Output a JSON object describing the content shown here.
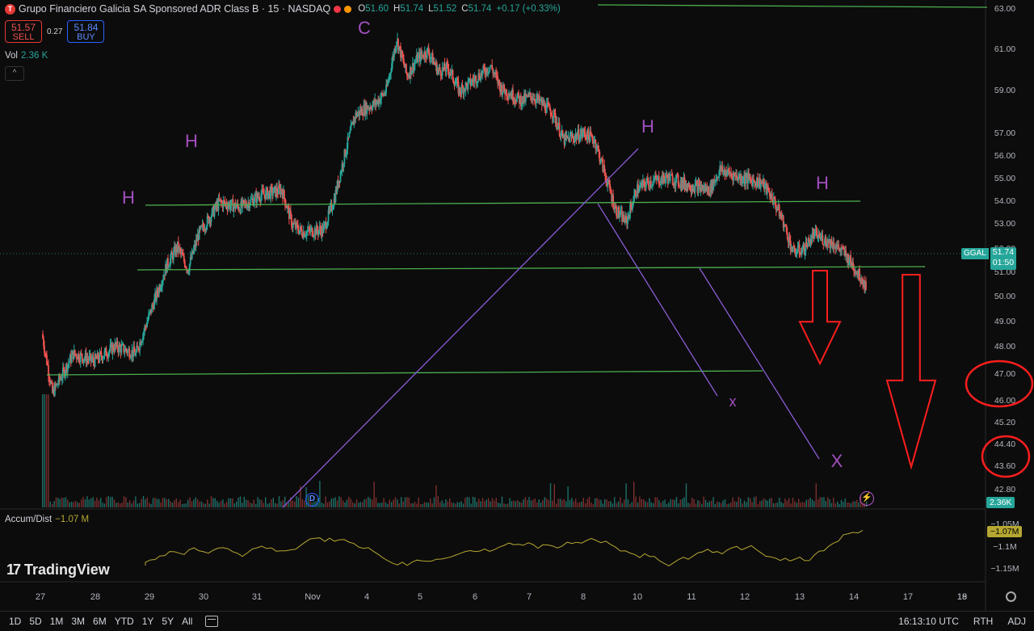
{
  "header": {
    "symbol_icon": "T",
    "title": "Grupo Financiero Galicia SA Sponsored ADR Class B · 15 · NASDAQ",
    "ohlc": {
      "o": "51.60",
      "h": "51.74",
      "l": "51.52",
      "c": "51.74",
      "change": "+0.17 (+0.33%)"
    },
    "ohlc_labels": {
      "o": "O",
      "h": "H",
      "l": "L",
      "c": "C"
    },
    "dot_colors": [
      "#f23645",
      "#ff9800"
    ]
  },
  "trade": {
    "sell_price": "51.57",
    "sell_label": "SELL",
    "spread": "0.27",
    "buy_price": "51.84",
    "buy_label": "BUY"
  },
  "volume_legend": {
    "label": "Vol",
    "value": "2.36 K"
  },
  "collapse_icon": "^",
  "ad_legend": {
    "label": "Accum/Dist",
    "value": "−1.07 M"
  },
  "logo": {
    "mark": "17",
    "text": "TradingView"
  },
  "price_tag": {
    "symbol": "GGAL",
    "price": "51.74",
    "countdown": "01:50"
  },
  "volume_tag": "2.36K",
  "ad_tag": "−1.07M",
  "dividend_marker": "D",
  "flash_icon": "⚡",
  "toolbar": {
    "timeframes": [
      "1D",
      "5D",
      "1M",
      "3M",
      "6M",
      "YTD",
      "1Y",
      "5Y",
      "All"
    ],
    "time": "16:13:10 UTC",
    "session": "RTH",
    "adjust": "ADJ"
  },
  "colors": {
    "up": "#26a69a",
    "down": "#ef5350",
    "support": "#4caf50",
    "trend": "#8a5bd6",
    "annotation": "#a34fbf",
    "arrow": "#ff1e1e",
    "accum": "#b5a732"
  },
  "chart_data": {
    "type": "candlestick",
    "ylim": [
      42.8,
      63.0
    ],
    "price_ticks": [
      "63.00",
      "61.00",
      "59.00",
      "57.00",
      "56.00",
      "55.00",
      "54.00",
      "53.00",
      "52.00",
      "51.00",
      "50.00",
      "49.00",
      "48.00",
      "47.00",
      "46.00",
      "45.20",
      "44.40",
      "43.60",
      "42.80"
    ],
    "x_labels": [
      "27",
      "28",
      "29",
      "30",
      "31",
      "Nov",
      "4",
      "5",
      "6",
      "7",
      "8",
      "10",
      "11",
      "12",
      "13",
      "14",
      "17",
      "18",
      "19"
    ],
    "ad_ticks": [
      "−1.05M",
      "−1.1M",
      "−1.15M"
    ],
    "price_path": [
      [
        0,
        49.8
      ],
      [
        1,
        47.4
      ],
      [
        3,
        49.0
      ],
      [
        5,
        48.7
      ],
      [
        7,
        49.3
      ],
      [
        9,
        49.0
      ],
      [
        10,
        50.2
      ],
      [
        12,
        52.6
      ],
      [
        13,
        53.3
      ],
      [
        14,
        52.4
      ],
      [
        15,
        53.8
      ],
      [
        17,
        55.1
      ],
      [
        19,
        54.9
      ],
      [
        21,
        55.4
      ],
      [
        23,
        55.6
      ],
      [
        24,
        54.2
      ],
      [
        25,
        53.9
      ],
      [
        27,
        54.0
      ],
      [
        28,
        55.2
      ],
      [
        29,
        57.0
      ],
      [
        30,
        58.6
      ],
      [
        31,
        58.9
      ],
      [
        32,
        59.1
      ],
      [
        33,
        59.6
      ],
      [
        34,
        61.7
      ],
      [
        35,
        60.2
      ],
      [
        36,
        60.9
      ],
      [
        37,
        61.2
      ],
      [
        38,
        60.4
      ],
      [
        39,
        60.5
      ],
      [
        40,
        59.6
      ],
      [
        41,
        59.9
      ],
      [
        43,
        60.6
      ],
      [
        44,
        59.7
      ],
      [
        46,
        59.2
      ],
      [
        47,
        59.4
      ],
      [
        49,
        58.7
      ],
      [
        50,
        57.6
      ],
      [
        52,
        57.9
      ],
      [
        53,
        57.6
      ],
      [
        54,
        56.2
      ],
      [
        55,
        54.8
      ],
      [
        56,
        54.3
      ],
      [
        57,
        55.6
      ],
      [
        58,
        55.9
      ],
      [
        60,
        56.1
      ],
      [
        62,
        55.8
      ],
      [
        64,
        55.6
      ],
      [
        65,
        56.4
      ],
      [
        67,
        56.1
      ],
      [
        69,
        55.9
      ],
      [
        70,
        55.3
      ],
      [
        71,
        54.4
      ],
      [
        72,
        53.1
      ],
      [
        73,
        53.2
      ],
      [
        74,
        53.8
      ],
      [
        75,
        53.6
      ],
      [
        76,
        53.4
      ],
      [
        77,
        53.0
      ],
      [
        78,
        52.4
      ],
      [
        79,
        51.74
      ]
    ],
    "support_lines": [
      {
        "x1": 0.3,
        "y1": 53.75,
        "x2": 1.1,
        "y2": 53.92
      },
      {
        "x1": 0.24,
        "y1": 51.08,
        "x2": 1.34,
        "y2": 51.18
      },
      {
        "x1": 0.0,
        "y1": 46.95,
        "x2": 1.0,
        "y2": 47.1
      },
      {
        "x1": 0.68,
        "y1": 63.0,
        "x2": 1.2,
        "y2": 63.0
      }
    ],
    "annotations": [
      {
        "text": "H",
        "x": 3,
        "y": 53.9
      },
      {
        "text": "H",
        "x": 6,
        "y": 56.4
      },
      {
        "text": "C",
        "x": 14,
        "y": 62.3
      },
      {
        "text": "H",
        "x": 24,
        "y": 56.9
      },
      {
        "text": "H",
        "x": 30,
        "y": 54.5
      },
      {
        "text": "x",
        "x": 27,
        "y": 45.8
      },
      {
        "text": "X",
        "x": 31,
        "y": 43.6
      }
    ]
  }
}
